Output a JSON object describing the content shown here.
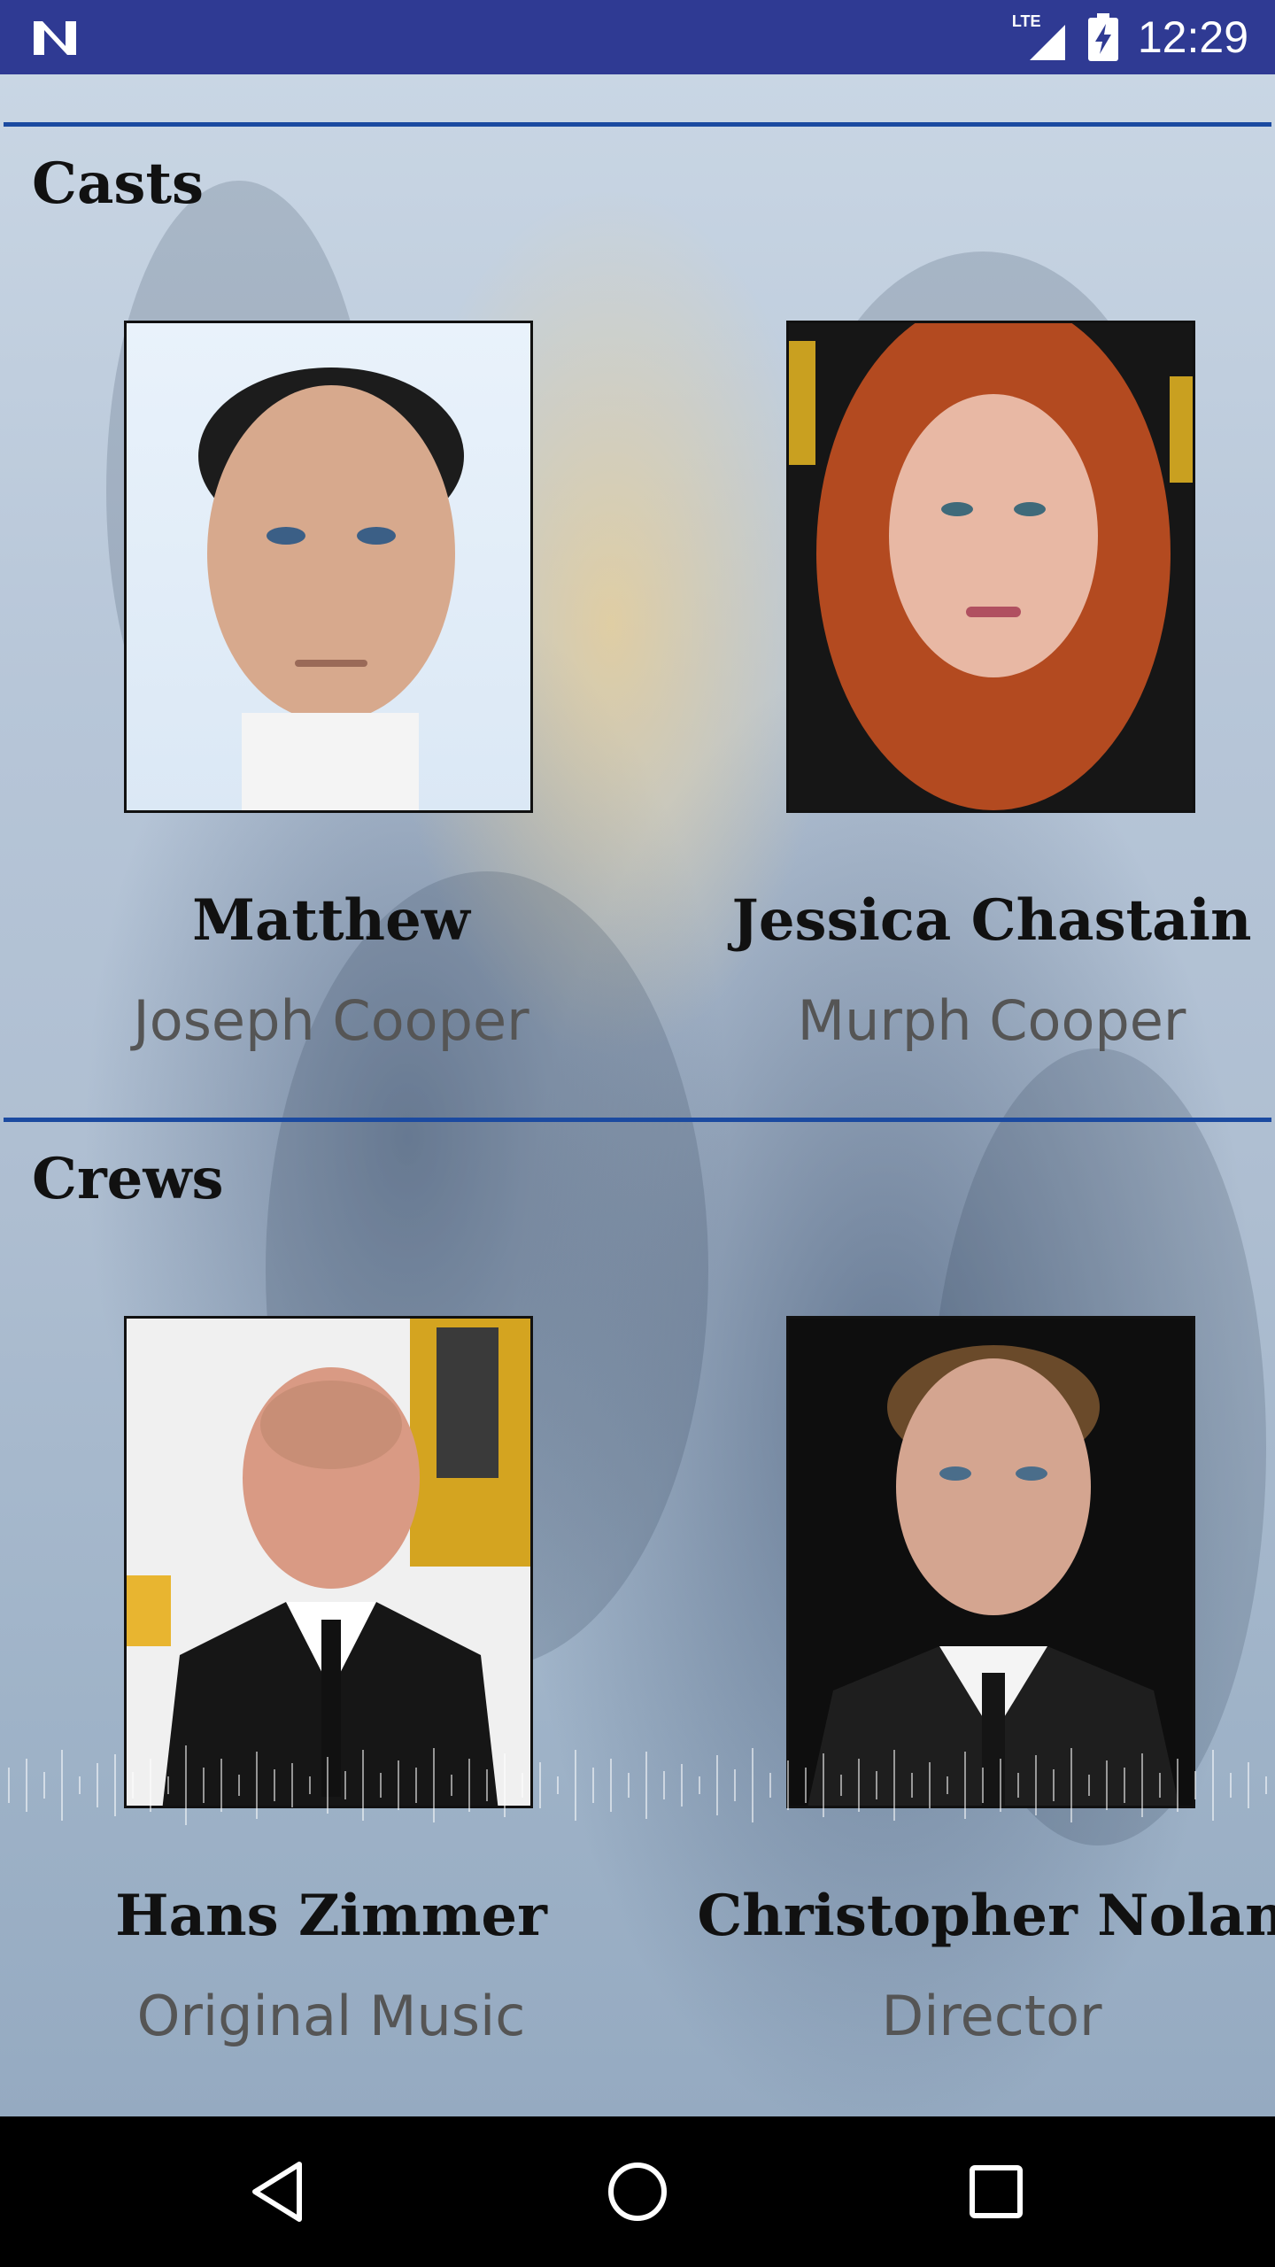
{
  "status_bar": {
    "time": "12:29",
    "network": "LTE",
    "icons": [
      "notification-n-icon",
      "signal-icon",
      "battery-charging-icon"
    ]
  },
  "casts": {
    "title": "Casts",
    "people": [
      {
        "name": "Matthew",
        "role": "Joseph Cooper"
      },
      {
        "name": "Jessica Chastain",
        "role": "Murph Cooper"
      }
    ]
  },
  "crews": {
    "title": "Crews",
    "people": [
      {
        "name": "Hans Zimmer",
        "role": "Original Music"
      },
      {
        "name": "Christopher Nolan",
        "role": "Director"
      }
    ]
  },
  "nav_bar": {
    "icons": [
      "back-icon",
      "home-icon",
      "recents-icon"
    ]
  },
  "colors": {
    "status_bar": "#2f3a93",
    "divider": "#1b4aa0",
    "nav_bar": "#000000"
  }
}
